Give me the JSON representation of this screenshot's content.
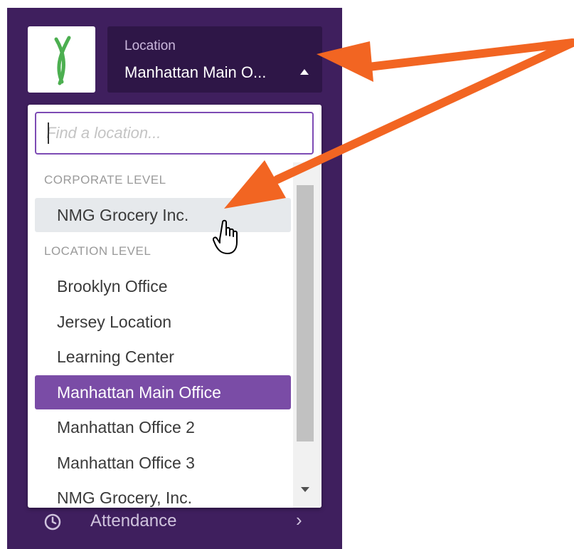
{
  "location_switcher": {
    "caption": "Location",
    "current": "Manhattan Main O..."
  },
  "dropdown": {
    "search_placeholder": "Find a location...",
    "groups": [
      {
        "header": "CORPORATE LEVEL",
        "items": [
          "NMG Grocery Inc."
        ]
      },
      {
        "header": "LOCATION LEVEL",
        "items": [
          "Brooklyn Office",
          "Jersey Location",
          "Learning Center",
          "Manhattan Main Office",
          "Manhattan Office 2",
          "Manhattan Office 3",
          "NMG Grocery, Inc."
        ]
      }
    ],
    "hovered_item": "NMG Grocery Inc.",
    "selected_item": "Manhattan Main Office"
  },
  "nav": {
    "attendance_label": "Attendance",
    "attendance_icon": "clock-icon"
  },
  "colors": {
    "sidebar": "#3f1f5e",
    "switcher": "#2e1647",
    "selected": "#7a4ca6",
    "annotation_arrow": "#f26522"
  }
}
